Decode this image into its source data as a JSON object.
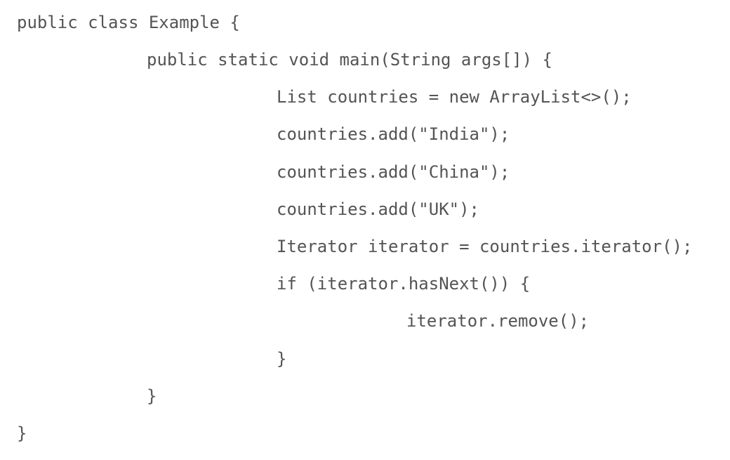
{
  "code": {
    "language": "Java",
    "lines": [
      "public class Example {",
      "public static void main(String args[]) {",
      "List countries = new ArrayList<>();",
      "countries.add(\"India\");",
      "countries.add(\"China\");",
      "countries.add(\"UK\");",
      "Iterator iterator = countries.iterator();",
      "if (iterator.hasNext()) {",
      "iterator.remove();",
      "}",
      "}",
      "}"
    ]
  },
  "colors": {
    "text": "#545454",
    "background": "#ffffff"
  }
}
